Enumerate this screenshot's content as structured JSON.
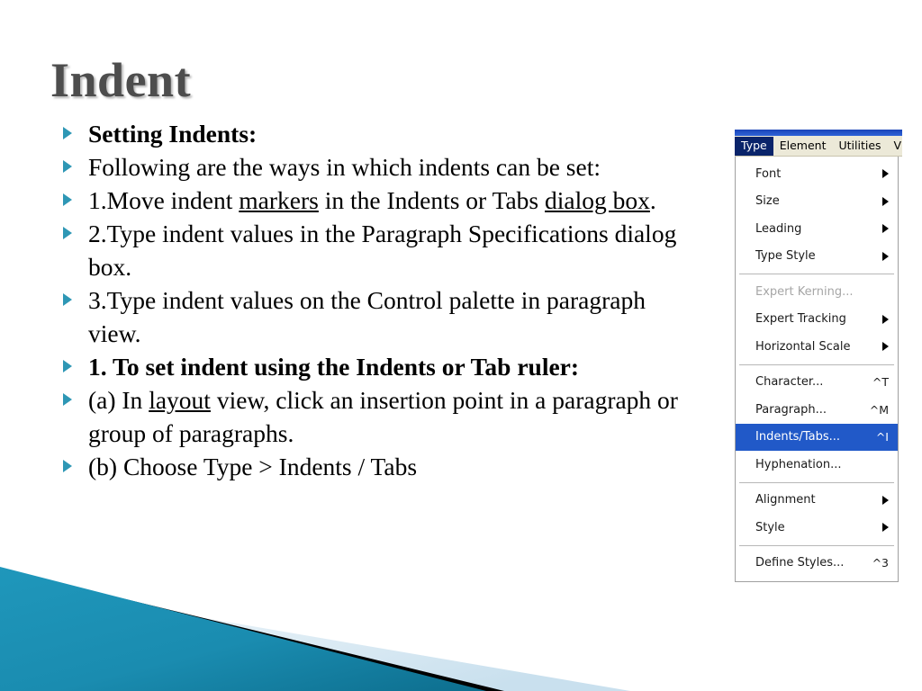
{
  "slide": {
    "title": "Indent",
    "background_color": "#ffffff",
    "accent_color": "#2e97b5",
    "title_color": "#4d4d4d",
    "bullets": [
      {
        "bold": true,
        "runs": [
          {
            "text": "Setting Indents:",
            "underline": false
          }
        ]
      },
      {
        "bold": false,
        "runs": [
          {
            "text": "Following are the ways in which indents can be set:",
            "underline": false
          }
        ]
      },
      {
        "bold": false,
        "runs": [
          {
            "text": "1.Move indent ",
            "underline": false
          },
          {
            "text": "markers",
            "underline": true
          },
          {
            "text": " in the Indents or Tabs ",
            "underline": false
          },
          {
            "text": "dialog box",
            "underline": true
          },
          {
            "text": ".",
            "underline": false
          }
        ]
      },
      {
        "bold": false,
        "runs": [
          {
            "text": "2.Type indent values in the Paragraph Specifications dialog box.",
            "underline": false
          }
        ]
      },
      {
        "bold": false,
        "runs": [
          {
            "text": "3.Type indent values on the Control palette in paragraph view.",
            "underline": false
          }
        ]
      },
      {
        "bold": true,
        "runs": [
          {
            "text": "1. To set indent using the Indents or Tab ruler:",
            "underline": false
          }
        ]
      },
      {
        "bold": false,
        "runs": [
          {
            "text": "(a) In ",
            "underline": false
          },
          {
            "text": "layout",
            "underline": true
          },
          {
            "text": " view, click an insertion point in a paragraph or group of paragraphs.",
            "underline": false
          }
        ]
      },
      {
        "bold": false,
        "runs": [
          {
            "text": "(b) Choose Type > Indents / Tabs",
            "underline": false
          }
        ]
      }
    ]
  },
  "menu_screenshot": {
    "menubar": [
      {
        "label": "Type",
        "active": true
      },
      {
        "label": "Element",
        "active": false
      },
      {
        "label": "Utilities",
        "active": false
      },
      {
        "label": "V",
        "active": false
      }
    ],
    "highlight_color": "#2159c8",
    "menubar_active_color": "#0a246a",
    "items": [
      {
        "type": "item",
        "label": "Font",
        "accel": "",
        "submenu": true,
        "disabled": false,
        "highlight": false
      },
      {
        "type": "item",
        "label": "Size",
        "accel": "",
        "submenu": true,
        "disabled": false,
        "highlight": false
      },
      {
        "type": "item",
        "label": "Leading",
        "accel": "",
        "submenu": true,
        "disabled": false,
        "highlight": false
      },
      {
        "type": "item",
        "label": "Type Style",
        "accel": "",
        "submenu": true,
        "disabled": false,
        "highlight": false
      },
      {
        "type": "separator"
      },
      {
        "type": "item",
        "label": "Expert Kerning...",
        "accel": "",
        "submenu": false,
        "disabled": true,
        "highlight": false
      },
      {
        "type": "item",
        "label": "Expert Tracking",
        "accel": "",
        "submenu": true,
        "disabled": false,
        "highlight": false
      },
      {
        "type": "item",
        "label": "Horizontal Scale",
        "accel": "",
        "submenu": true,
        "disabled": false,
        "highlight": false
      },
      {
        "type": "separator"
      },
      {
        "type": "item",
        "label": "Character...",
        "accel": "^T",
        "submenu": false,
        "disabled": false,
        "highlight": false
      },
      {
        "type": "item",
        "label": "Paragraph...",
        "accel": "^M",
        "submenu": false,
        "disabled": false,
        "highlight": false
      },
      {
        "type": "item",
        "label": "Indents/Tabs...",
        "accel": "^I",
        "submenu": false,
        "disabled": false,
        "highlight": true
      },
      {
        "type": "item",
        "label": "Hyphenation...",
        "accel": "",
        "submenu": false,
        "disabled": false,
        "highlight": false
      },
      {
        "type": "separator"
      },
      {
        "type": "item",
        "label": "Alignment",
        "accel": "",
        "submenu": true,
        "disabled": false,
        "highlight": false
      },
      {
        "type": "item",
        "label": "Style",
        "accel": "",
        "submenu": true,
        "disabled": false,
        "highlight": false
      },
      {
        "type": "separator"
      },
      {
        "type": "item",
        "label": "Define Styles...",
        "accel": "^3",
        "submenu": false,
        "disabled": false,
        "highlight": false
      }
    ]
  },
  "decoration": {
    "teal_color": "#1a8cb0",
    "teal_color_dark": "#0f7495",
    "black_color": "#000000",
    "pale_blue_color": "#dbe9f2"
  }
}
